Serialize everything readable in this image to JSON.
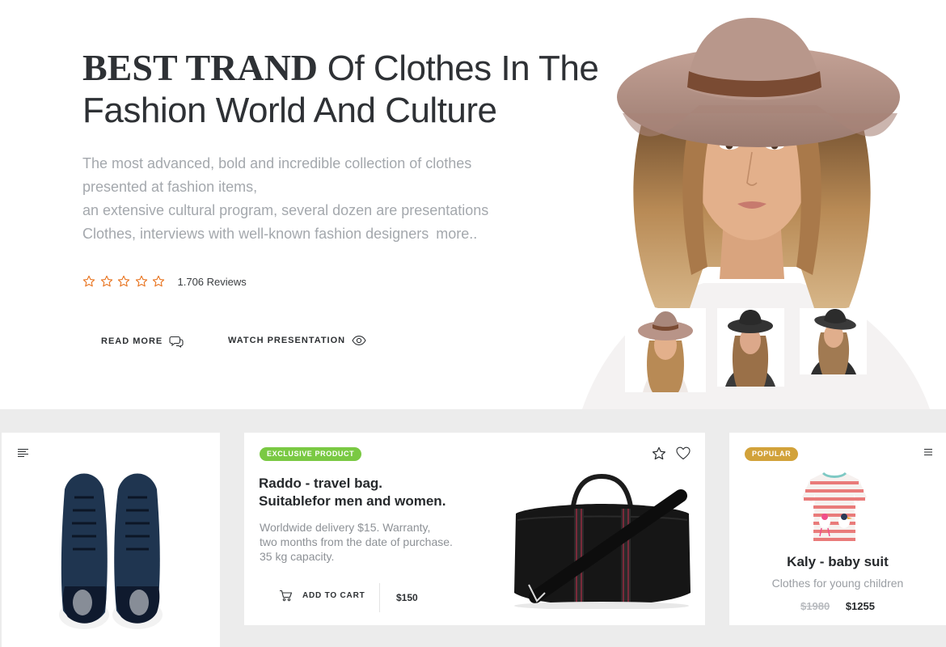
{
  "hero": {
    "title_strong": "BEST TRAND",
    "title_rest": " Of Clothes In The Fashion World And Culture",
    "desc_lines": [
      "The most advanced, bold and incredible collection of clothes",
      "presented at fashion items,",
      "an extensive cultural program, several dozen are presentations",
      "Clothes, interviews with well-known fashion designers"
    ],
    "more_link": "more..",
    "rating_stars": 5,
    "reviews_label": "1.706 Reviews",
    "read_more_label": "READ MORE",
    "watch_label": "WATCH PRESENTATION",
    "accent_color": "#e8731e"
  },
  "product_mid": {
    "badge": "EXCLUSIVE PRODUCT",
    "title_line1": "Raddo - travel bag.",
    "title_line2": "Suitablefor men and women.",
    "desc_line1": "Worldwide delivery $15. Warranty,",
    "desc_line2": "two months from the date of purchase.",
    "desc_line3": "35 kg capacity.",
    "add_to_cart": "ADD TO CART",
    "price": "$150"
  },
  "product_right": {
    "badge": "POPULAR",
    "title": "Kaly - baby suit",
    "subtitle": "Clothes for young children",
    "old_price": "$1980",
    "price": "$1255"
  },
  "colors": {
    "badge_green": "#7ac943",
    "badge_gold": "#d2a23a",
    "star_orange": "#e8731e"
  }
}
